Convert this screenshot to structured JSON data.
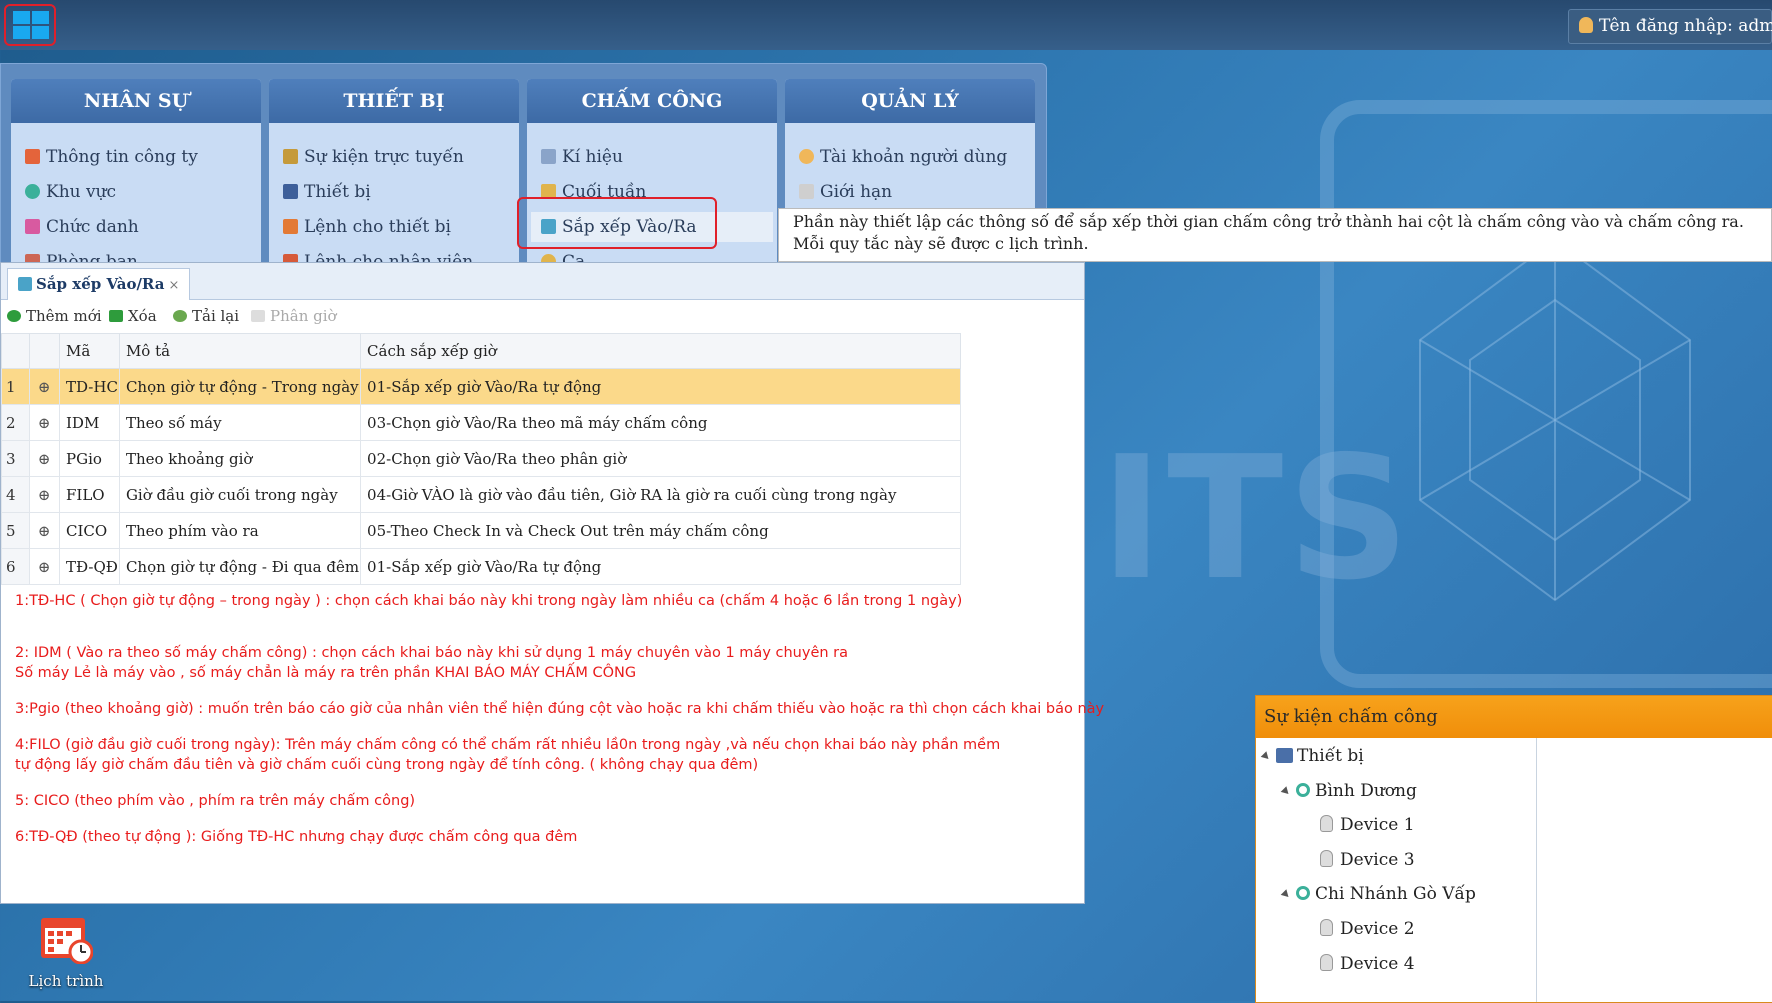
{
  "topbar": {
    "login_text": "Tên đăng nhập: admin"
  },
  "menu": {
    "columns": [
      {
        "title": "NHÂN SỰ",
        "items": [
          "Thông tin công ty",
          "Khu vực",
          "Chức danh",
          "Phòng ban"
        ]
      },
      {
        "title": "THIẾT BỊ",
        "items": [
          "Sự kiện trực tuyến",
          "Thiết bị",
          "Lệnh cho thiết bị",
          "Lệnh cho nhân viên"
        ]
      },
      {
        "title": "CHẤM CÔNG",
        "items": [
          "Kí hiệu",
          "Cuối tuần",
          "Sắp xếp Vào/Ra",
          "Ca"
        ]
      },
      {
        "title": "QUẢN LÝ",
        "items": [
          "Tài khoản người dùng",
          "Giới hạn"
        ]
      }
    ],
    "tooltip": "Phần này thiết lập các thông số để sắp xếp thời gian chấm công trở thành hai cột là chấm công vào và chấm công ra. Mỗi quy tắc này sẽ được c lịch trình."
  },
  "window": {
    "tab_label": "Sắp xếp Vào/Ra",
    "tab_close": "×",
    "toolbar": {
      "add": "Thêm mới",
      "delete": "Xóa",
      "reload": "Tải lại",
      "assign": "Phân giờ"
    },
    "columns": [
      "Mã",
      "Mô tả",
      "Cách sắp xếp giờ"
    ],
    "rows": [
      {
        "num": "1",
        "code": "TD-HC",
        "desc": "Chọn giờ tự động - Trong ngày",
        "method": "01-Sắp xếp giờ Vào/Ra tự động"
      },
      {
        "num": "2",
        "code": "IDM",
        "desc": "Theo số máy",
        "method": "03-Chọn giờ Vào/Ra theo mã máy chấm công"
      },
      {
        "num": "3",
        "code": "PGio",
        "desc": "Theo khoảng giờ",
        "method": "02-Chọn giờ Vào/Ra theo phân giờ"
      },
      {
        "num": "4",
        "code": "FILO",
        "desc": "Giờ đầu giờ cuối trong ngày",
        "method": "04-Giờ VÀO là giờ vào đầu tiên, Giờ RA là giờ ra cuối cùng trong ngày"
      },
      {
        "num": "5",
        "code": "CICO",
        "desc": "Theo phím vào ra",
        "method": "05-Theo Check In và Check Out trên máy chấm công"
      },
      {
        "num": "6",
        "code": "TĐ-QĐ",
        "desc": "Chọn giờ tự động - Đi qua đêm",
        "method": "01-Sắp xếp giờ Vào/Ra tự động"
      }
    ],
    "notes": [
      "1:TĐ-HC ( Chọn giờ tự động – trong ngày ) : chọn cách khai báo này khi trong ngày làm nhiều ca (chấm 4 hoặc 6 lần trong 1 ngày)",
      "2: IDM ( Vào ra theo số máy chấm công) : chọn cách khai báo này khi sử dụng 1 máy chuyên vào 1 máy chuyên ra",
      "Số máy Lẻ là máy vào , số máy chẳn là máy ra  trên phần KHAI BÁO MÁY CHẤM CÔNG",
      "3:Pgio (theo khoảng giờ) : muốn trên báo cáo giờ của nhân viên thể hiện đúng cột vào hoặc ra khi chấm thiếu vào hoặc ra thì chọn cách khai báo này",
      "4:FILO (giờ đầu giờ cuối trong ngày): Trên máy chấm công có thể chấm rất nhiều lầ0n trong ngày ,và nếu chọn khai báo này phần mềm",
      "tự động lấy giờ chấm đầu tiên và giờ chấm cuối cùng trong ngày để tính công. ( không chạy qua đêm)",
      "5: CICO (theo phím vào  , phím ra trên máy chấm công)",
      "6:TĐ-QĐ (theo tự động ): Giống TĐ-HC nhưng chạy được chấm công qua đêm"
    ]
  },
  "desktop": {
    "icon_label": "Lịch trình"
  },
  "events": {
    "title": "Sự kiện chấm công",
    "tree": {
      "root": "Thiết bị",
      "branches": [
        {
          "name": "Bình Dương",
          "devices": [
            "Device 1",
            "Device 3"
          ]
        },
        {
          "name": "Chi Nhánh Gò Vấp",
          "devices": [
            "Device 2",
            "Device 4"
          ]
        }
      ]
    }
  },
  "colors": {
    "accent_orange": "#f29a12",
    "selected_row": "#fbd98a",
    "note_red": "#e81c1c",
    "highlight_border": "#e0202a"
  }
}
